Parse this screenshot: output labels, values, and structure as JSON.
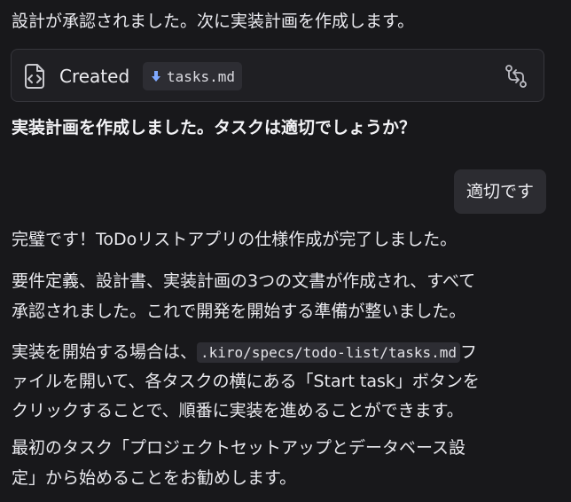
{
  "messages": {
    "approved": "設計が承認されました。次に実装計画を作成します。",
    "created_card": {
      "action": "Created",
      "filename": "tasks.md",
      "file_icon": "file-code-icon",
      "download_icon": "download-arrow-icon",
      "sync_icon": "sync-diff-icon"
    },
    "question": "実装計画を作成しました。タスクは適切でしょうか？",
    "user_reply": "適切です",
    "p1": "完璧です！ToDoリストアプリの仕様作成が完了しました。",
    "p2_line1": "要件定義、設計書、実装計画の3つの文書が作成され、すべて",
    "p2_line2": "承認されました。これで開発を開始する準備が整いました。",
    "p3_line1_prefix": "実装を開始する場合は、",
    "p3_code": ".kiro/specs/todo-list/tasks.md",
    "p3_line1_suffix": "フ",
    "p3_line2": "ァイルを開いて、各タスクの横にある「Start task」ボタンを",
    "p3_line3": "クリックすることで、順番に実装を進めることができます。",
    "p4_line1": "最初のタスク「プロジェクトセットアップとデータベース設",
    "p4_line2": "定」から始めることをお勧めします。"
  },
  "colors": {
    "background": "#18181b",
    "card": "#1f1f23",
    "chip": "#2d2d33",
    "bubble": "#2c2c31",
    "text": "#e9e9ee"
  }
}
